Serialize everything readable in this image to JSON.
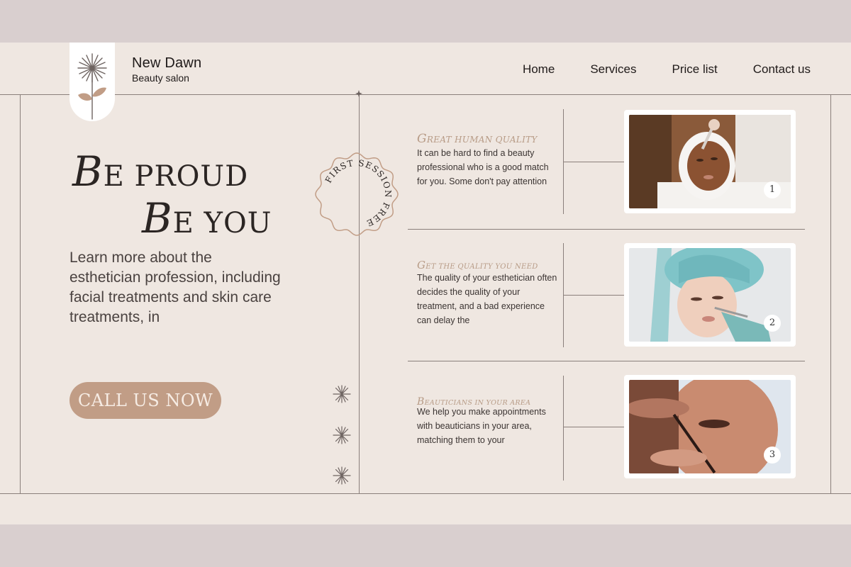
{
  "brand": {
    "name": "New Dawn",
    "tagline": "Beauty salon"
  },
  "nav": {
    "items": [
      "Home",
      "Services",
      "Price list",
      "Contact us"
    ]
  },
  "hero": {
    "line1_cap": "B",
    "line1_rest": "E PROUD",
    "line2_cap": "B",
    "line2_rest": "E YOU",
    "description": "Learn more about the esthetician profession, including facial treatments and skin care treatments, in",
    "cta_label": "CALL US NOW"
  },
  "seal": {
    "text": "FIRST SESSION FREE"
  },
  "features": [
    {
      "title_cap": "G",
      "title_rest": "REAT HUMAN QUALITY",
      "text": "It can be hard to find a beauty professional who is a good match for you. Some don't pay attention",
      "number": "1"
    },
    {
      "title_cap": "G",
      "title_rest": "ET THE QUALITY YOU NEED",
      "text": "The quality of your esthetician often decides the quality of your treatment, and a bad experience can delay the",
      "number": "2"
    },
    {
      "title_cap": "B",
      "title_rest": "EAUTICIANS IN YOUR AREA",
      "text": "We help you make appointments with beauticians in your area, matching them to your",
      "number": "3"
    }
  ],
  "icons": {
    "logo": "flower-icon",
    "stars": [
      "sparkle-icon",
      "sparkle-icon",
      "sparkle-icon"
    ],
    "divider": "diamond-icon"
  },
  "colors": {
    "background": "#efe7e1",
    "frame": "#d9cfcf",
    "accent": "#c19d86",
    "accent_text": "#b79b86",
    "line": "#8a7f7b",
    "text": "#2b2523"
  }
}
